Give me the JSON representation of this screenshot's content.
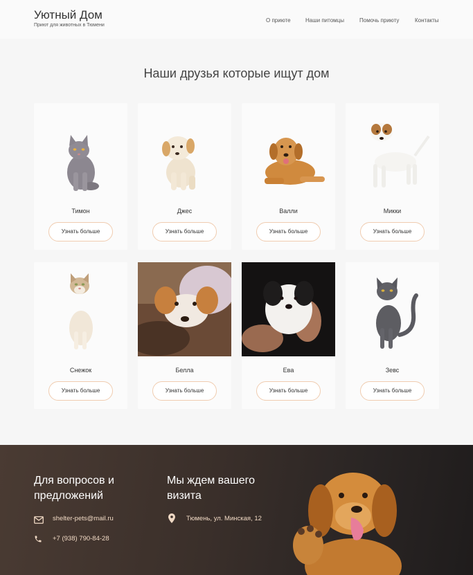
{
  "header": {
    "title": "Уютный Дом",
    "subtitle": "Приют для животных в Тюмени",
    "nav": [
      "О приюте",
      "Наши питомцы",
      "Помочь приюту",
      "Контакты"
    ]
  },
  "main": {
    "heading": "Наши друзья которые ищут дом",
    "button_label": "Узнать больше",
    "pets": [
      {
        "name": "Тимон"
      },
      {
        "name": "Джес"
      },
      {
        "name": "Валли"
      },
      {
        "name": "Микки"
      },
      {
        "name": "Снежок"
      },
      {
        "name": "Белла"
      },
      {
        "name": "Ева"
      },
      {
        "name": "Зевс"
      }
    ]
  },
  "footer": {
    "questions_title_1": "Для вопросов и",
    "questions_title_2": "предложений",
    "email": "shelter-pets@mail.ru",
    "phone": "+7 (938) 790-84-28",
    "visit_title_1": "Мы ждем вашего",
    "visit_title_2": "визита",
    "address": "Тюмень, ул. Минская, 12"
  },
  "colors": {
    "accent": "#f0ccb0",
    "footer_bg": "#3a2f2a",
    "footer_text": "#f0d9c4"
  }
}
